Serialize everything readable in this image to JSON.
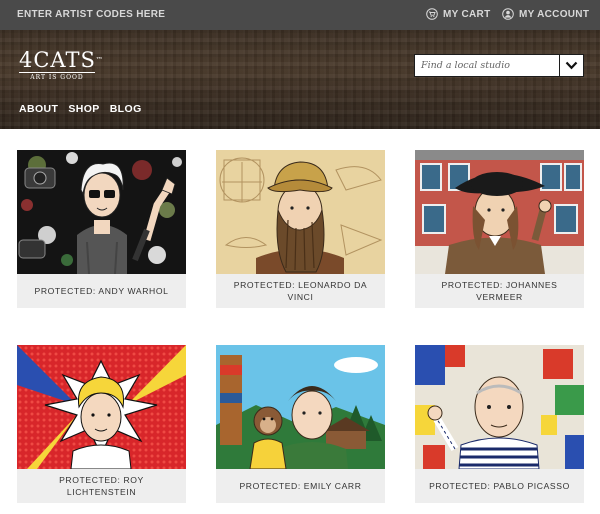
{
  "topbar": {
    "artist_codes": "ENTER ARTIST CODES HERE",
    "cart": {
      "label": "MY CART",
      "icon": "cart-icon"
    },
    "account": {
      "label": "MY ACCOUNT",
      "icon": "user-icon"
    }
  },
  "header": {
    "logo": {
      "word": "4CATS",
      "tagline": "ART IS GOOD"
    },
    "nav": [
      "ABOUT",
      "SHOP",
      "BLOG"
    ],
    "studio_search": {
      "placeholder": "Find a local studio",
      "icon": "chevron-down-icon"
    }
  },
  "cards": [
    {
      "caption": "PROTECTED: ANDY WARHOL"
    },
    {
      "caption": "PROTECTED: LEONARDO DA VINCI"
    },
    {
      "caption": "PROTECTED: JOHANNES VERMEER"
    },
    {
      "caption": "PROTECTED: ROY LICHTENSTEIN"
    },
    {
      "caption": "PROTECTED: EMILY CARR"
    },
    {
      "caption": "PROTECTED: PABLO PICASSO"
    }
  ],
  "colors": {
    "topbar_bg": "#4a4a4a",
    "header_wood": "#3e3125",
    "caption_bg": "#eeeeee"
  }
}
